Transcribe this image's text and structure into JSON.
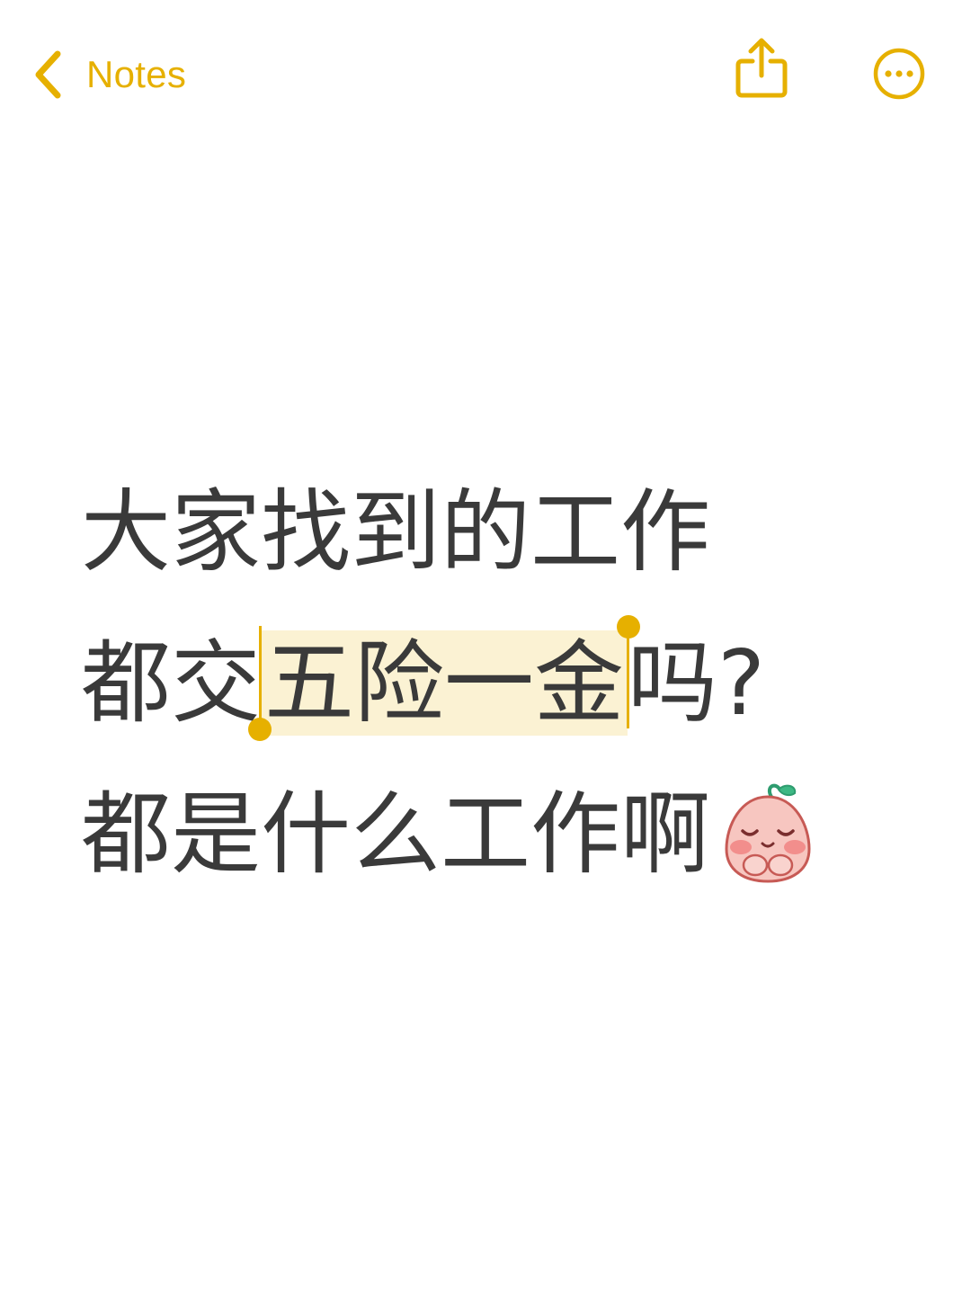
{
  "nav": {
    "back_label": "Notes",
    "back_icon": "chevron-left-icon",
    "share_icon": "share-icon",
    "more_icon": "ellipsis-circle-icon"
  },
  "note": {
    "line1": "大家找到的工作",
    "line2_before": "都交",
    "line2_selected": "五险一金",
    "line2_after": "吗?",
    "line3": "都是什么工作啊",
    "emoji": "blushing-peach-emoji"
  },
  "colors": {
    "accent": "#E6B000",
    "text": "#3a3a3a",
    "selection": "#FBF2D3",
    "background": "#ffffff"
  }
}
